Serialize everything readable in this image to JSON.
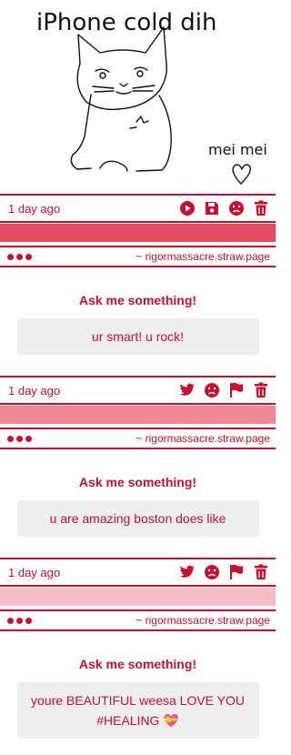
{
  "drawing": {
    "title_text": "iPhone cold dih",
    "signature_text": "meimei"
  },
  "posts": [
    {
      "time": "1 day ago",
      "icons": [
        "play-icon",
        "save-icon",
        "sad-face-icon",
        "trash-icon"
      ],
      "strip_color": "#e44c63",
      "site": "~ rigormassacre.straw.page",
      "prompt": "Ask me something!",
      "answer": "ur smart! u rock!"
    },
    {
      "time": "1 day ago",
      "icons": [
        "twitter-icon",
        "sad-face-icon",
        "flag-icon",
        "trash-icon"
      ],
      "strip_color": "#ef8795",
      "site": "~ rigormassacre.straw.page",
      "prompt": "Ask me something!",
      "answer": "u are amazing boston does like"
    },
    {
      "time": "1 day ago",
      "icons": [
        "twitter-icon",
        "sad-face-icon",
        "flag-icon",
        "trash-icon"
      ],
      "strip_color": "#f6bcc4",
      "site": "~ rigormassacre.straw.page",
      "prompt": "Ask me something!",
      "answer": "youre BEAUTIFUL weesa LOVE YOU #HEALING 💝"
    }
  ],
  "colors": {
    "accent": "#c8102e",
    "answer_bg": "#efeeef"
  }
}
